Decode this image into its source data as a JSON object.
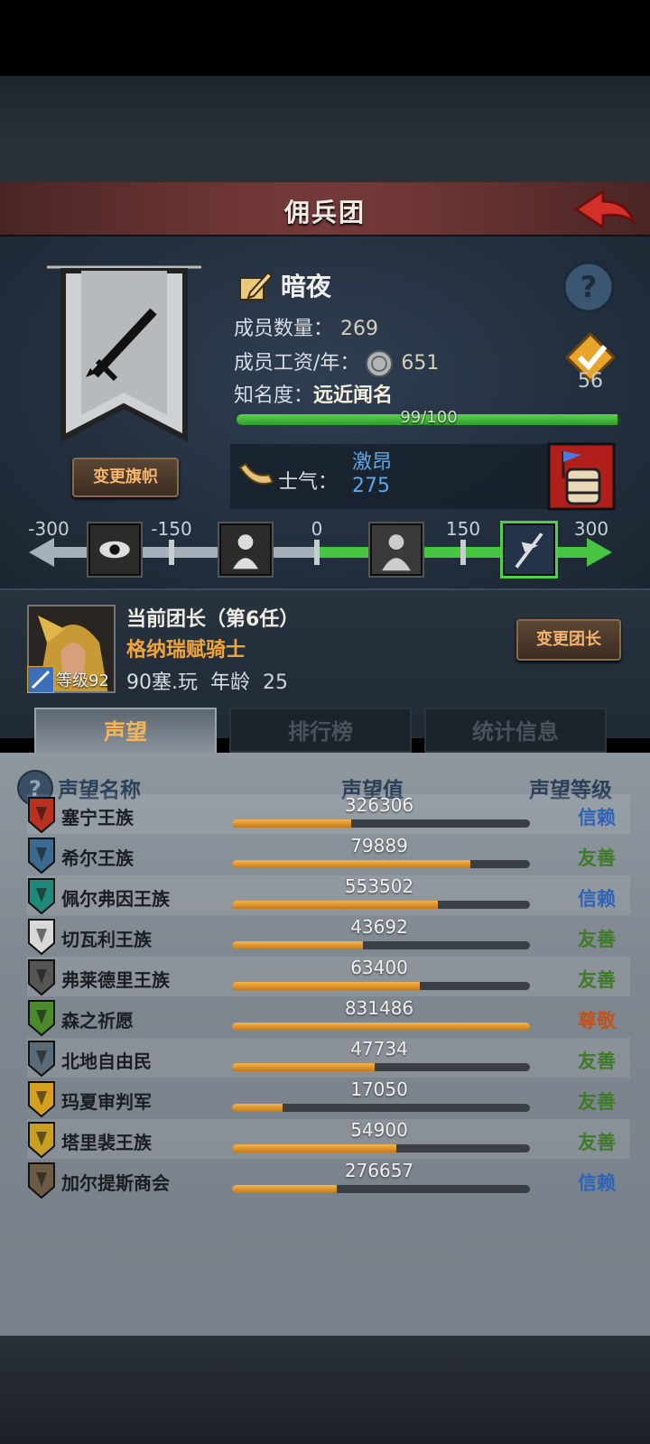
{
  "header": {
    "title": "佣兵团"
  },
  "guild": {
    "name": "暗夜",
    "members_label": "成员数量：",
    "members_value": "269",
    "wage_label": "成员工资/年：",
    "wage_value": "651",
    "fame_label": "知名度：",
    "fame_value": "远近闻名",
    "fame_progress_text": "99/100",
    "fame_progress": 0.99,
    "rank_value": "56",
    "change_banner_label": "变更旗帜"
  },
  "morale": {
    "label": "士气：",
    "state": "激昂",
    "value": "275",
    "scale_labels": [
      "-300",
      "-150",
      "0",
      "150",
      "300"
    ]
  },
  "leader": {
    "title": "当前团长（第6任）",
    "name": "格纳瑞赋骑士",
    "level_text": "等级92",
    "origin": "90塞.玩",
    "age_label": "年龄",
    "age_value": "25",
    "change_leader_label": "变更团长"
  },
  "tabs": [
    "声望",
    "排行榜",
    "统计信息"
  ],
  "list_header": {
    "name": "声望名称",
    "value": "声望值",
    "level": "声望等级"
  },
  "colors": {
    "trust": "#2d63b8",
    "friendly": "#3f7a2a",
    "respect": "#c0541e"
  },
  "factions": [
    {
      "name": "塞宁王族",
      "value": "326306",
      "progress": 0.4,
      "level": "信赖",
      "level_type": "trust",
      "icon": "red-shield-icon"
    },
    {
      "name": "希尔王族",
      "value": "79889",
      "progress": 0.8,
      "level": "友善",
      "level_type": "friendly",
      "icon": "blue-helm-shield-icon"
    },
    {
      "name": "佩尔弗因王族",
      "value": "553502",
      "progress": 0.69,
      "level": "信赖",
      "level_type": "trust",
      "icon": "teal-crescent-shield-icon"
    },
    {
      "name": "切瓦利王族",
      "value": "43692",
      "progress": 0.44,
      "level": "友善",
      "level_type": "friendly",
      "icon": "scales-shield-icon"
    },
    {
      "name": "弗莱德里王族",
      "value": "63400",
      "progress": 0.63,
      "level": "友善",
      "level_type": "friendly",
      "icon": "skull-shield-icon"
    },
    {
      "name": "森之祈愿",
      "value": "831486",
      "progress": 1.0,
      "level": "尊敬",
      "level_type": "respect",
      "icon": "green-tree-shield-icon"
    },
    {
      "name": "北地自由民",
      "value": "47734",
      "progress": 0.48,
      "level": "友善",
      "level_type": "friendly",
      "icon": "axe-shield-icon"
    },
    {
      "name": "玛夏审判军",
      "value": "17050",
      "progress": 0.17,
      "level": "友善",
      "level_type": "friendly",
      "icon": "gold-diamond-shield-icon"
    },
    {
      "name": "塔里裴王族",
      "value": "54900",
      "progress": 0.55,
      "level": "友善",
      "level_type": "friendly",
      "icon": "gold-crown-shield-icon"
    },
    {
      "name": "加尔提斯商会",
      "value": "276657",
      "progress": 0.35,
      "level": "信赖",
      "level_type": "trust",
      "icon": "chest-shield-icon"
    }
  ]
}
